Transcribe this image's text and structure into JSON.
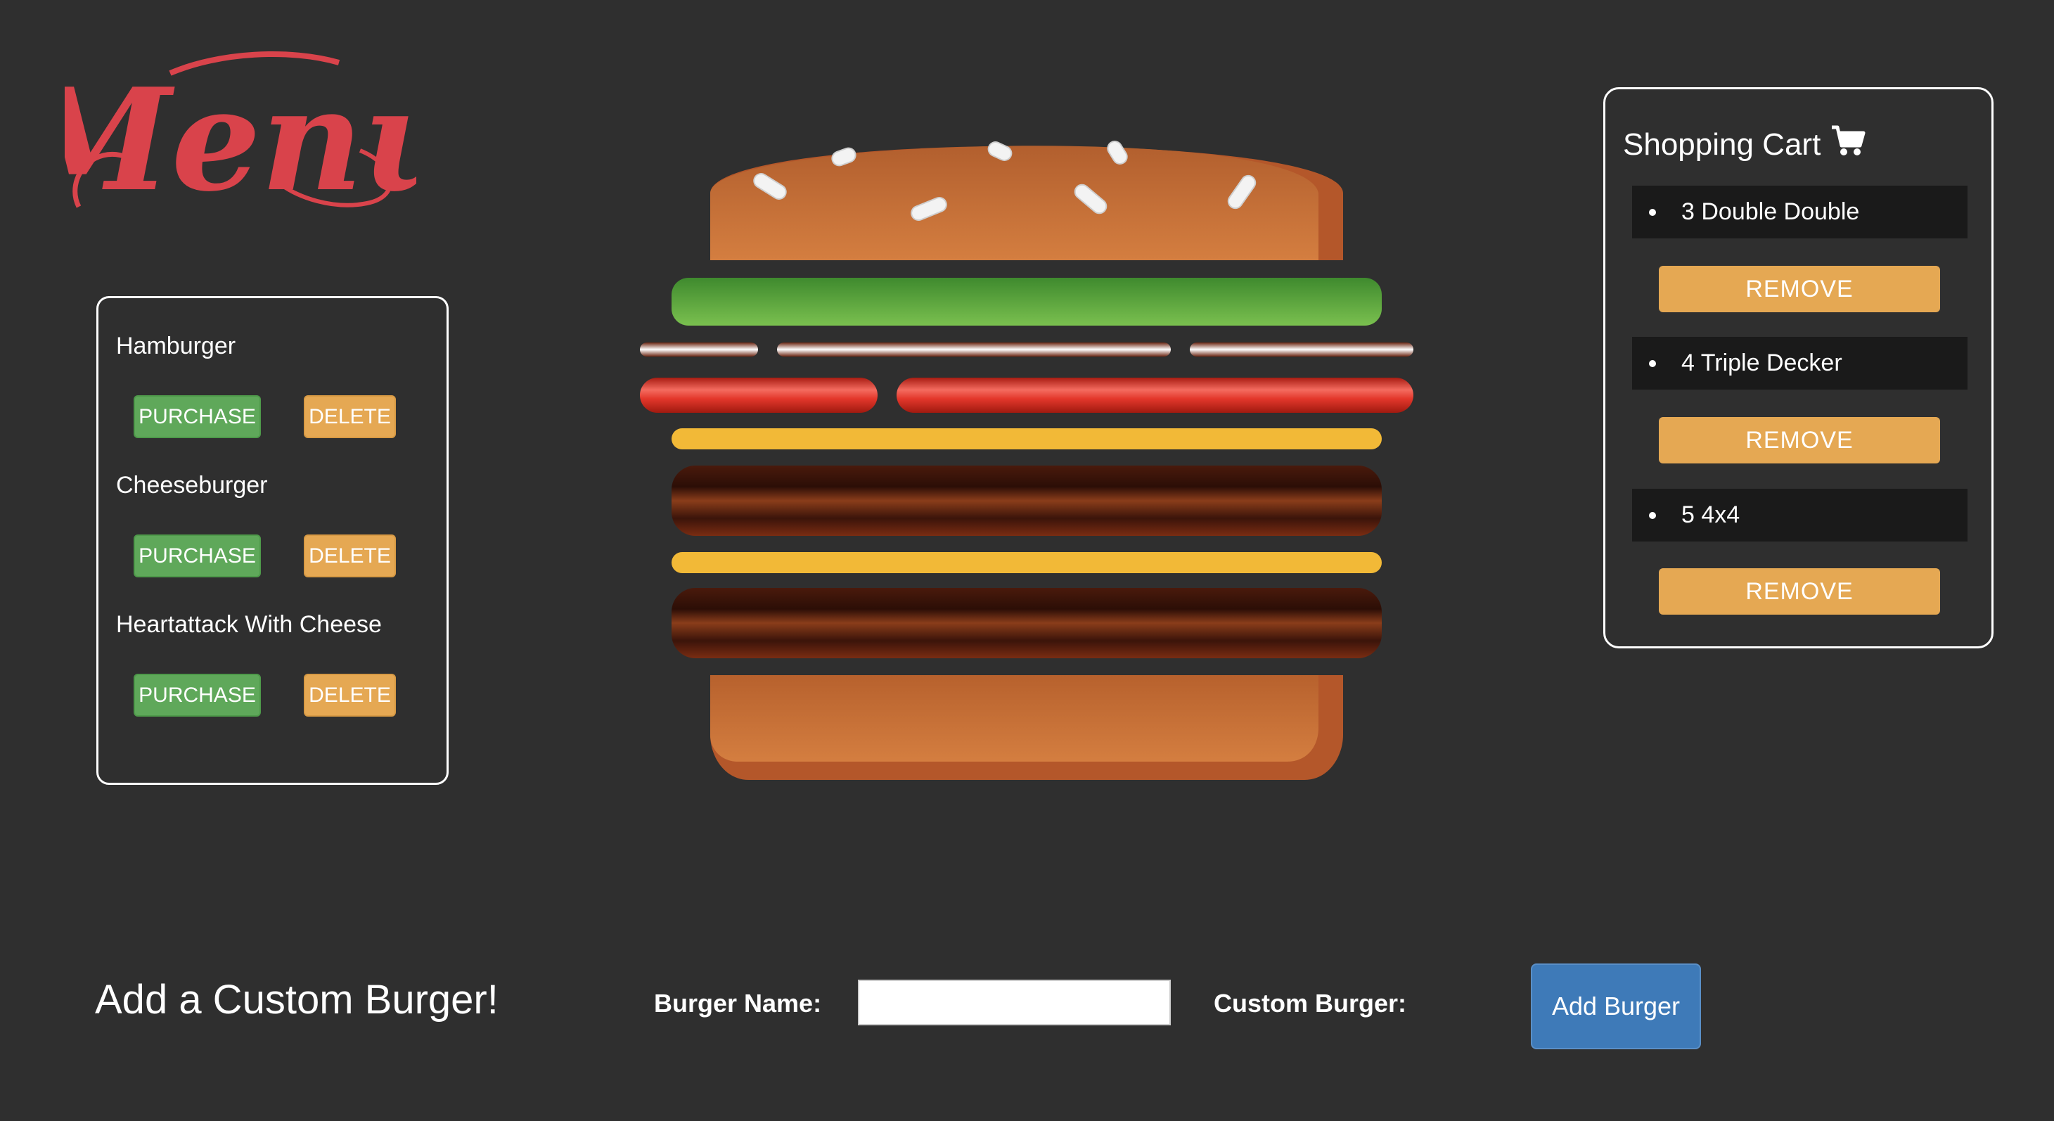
{
  "logo": {
    "text": "Menu"
  },
  "menu": {
    "items": [
      {
        "name": "Hamburger",
        "purchase_label": "PURCHASE",
        "delete_label": "DELETE"
      },
      {
        "name": "Cheeseburger",
        "purchase_label": "PURCHASE",
        "delete_label": "DELETE"
      },
      {
        "name": "Heartattack With Cheese",
        "purchase_label": "PURCHASE",
        "delete_label": "DELETE"
      }
    ]
  },
  "cart": {
    "title": "Shopping Cart",
    "icon": "cart-icon",
    "items": [
      {
        "label": "3 Double Double",
        "remove_label": "REMOVE"
      },
      {
        "label": "4 Triple Decker",
        "remove_label": "REMOVE"
      },
      {
        "label": "5 4x4",
        "remove_label": "REMOVE"
      }
    ]
  },
  "custom_form": {
    "heading": "Add a Custom Burger!",
    "name_label": "Burger Name:",
    "name_value": "",
    "custom_label": "Custom Burger:",
    "submit_label": "Add Burger"
  },
  "colors": {
    "background": "#2f2f2f",
    "purchase": "#5fa85a",
    "delete": "#e5a853",
    "remove": "#e5a853",
    "add_button": "#3e7ab8",
    "logo": "#d9434b"
  }
}
